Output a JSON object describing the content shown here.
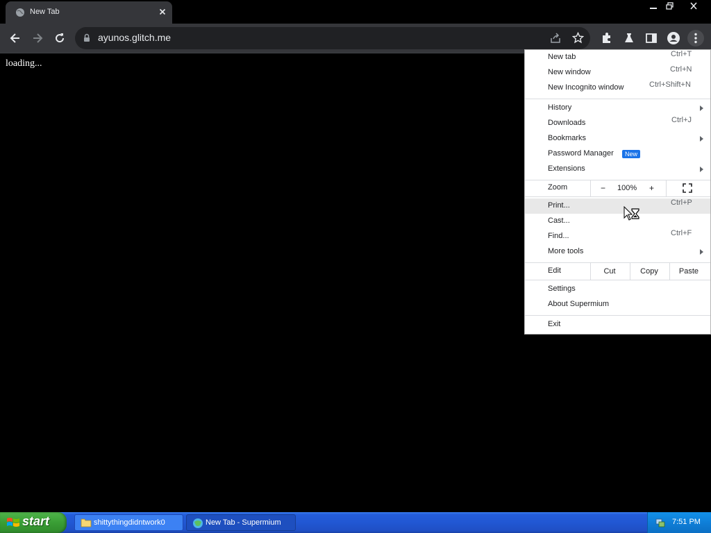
{
  "tab": {
    "title": "New Tab"
  },
  "omnibox": {
    "url": "ayunos.glitch.me"
  },
  "page": {
    "text": "loading..."
  },
  "menu": {
    "new_tab": {
      "label": "New tab",
      "shortcut": "Ctrl+T"
    },
    "new_window": {
      "label": "New window",
      "shortcut": "Ctrl+N"
    },
    "new_incognito": {
      "label": "New Incognito window",
      "shortcut": "Ctrl+Shift+N"
    },
    "history": {
      "label": "History"
    },
    "downloads": {
      "label": "Downloads",
      "shortcut": "Ctrl+J"
    },
    "bookmarks": {
      "label": "Bookmarks"
    },
    "password_manager": {
      "label": "Password Manager",
      "badge": "New"
    },
    "extensions": {
      "label": "Extensions"
    },
    "zoom": {
      "label": "Zoom",
      "minus": "−",
      "value": "100%",
      "plus": "+"
    },
    "print": {
      "label": "Print...",
      "shortcut": "Ctrl+P"
    },
    "cast": {
      "label": "Cast..."
    },
    "find": {
      "label": "Find...",
      "shortcut": "Ctrl+F"
    },
    "more_tools": {
      "label": "More tools"
    },
    "edit": {
      "label": "Edit",
      "cut": "Cut",
      "copy": "Copy",
      "paste": "Paste"
    },
    "settings": {
      "label": "Settings"
    },
    "about": {
      "label": "About Supermium"
    },
    "exit": {
      "label": "Exit"
    }
  },
  "taskbar": {
    "start_label": "start",
    "items": [
      {
        "label": "shittythingdidntwork0",
        "icon": "folder-icon"
      },
      {
        "label": "New Tab - Supermium",
        "icon": "browser-icon"
      }
    ],
    "clock": "7:51 PM"
  },
  "colors": {
    "tab_bg": "#35363a",
    "toolbar_bg": "#35363a",
    "omnibox_bg": "#202124",
    "badge_blue": "#1a73e8",
    "taskbar_blue": "#245edb",
    "start_green": "#3a9e35"
  }
}
